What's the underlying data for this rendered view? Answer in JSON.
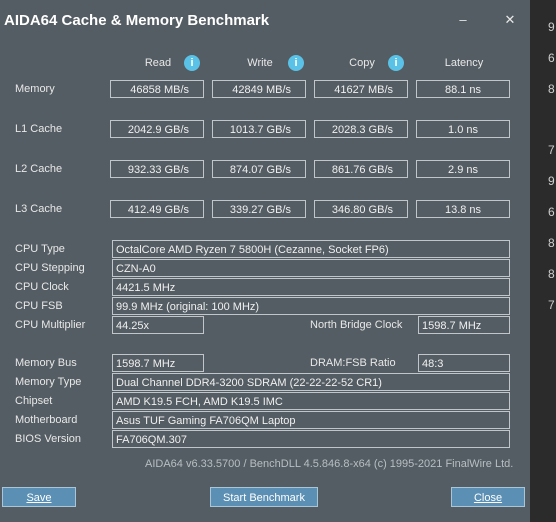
{
  "window": {
    "title": "AIDA64 Cache & Memory Benchmark",
    "minimize_glyph": "–",
    "close_glyph": "✕"
  },
  "columns": {
    "read": "Read",
    "write": "Write",
    "copy": "Copy",
    "latency": "Latency",
    "info_glyph": "i"
  },
  "rows": {
    "memory": {
      "label": "Memory",
      "read": "46858 MB/s",
      "write": "42849 MB/s",
      "copy": "41627 MB/s",
      "latency": "88.1 ns"
    },
    "l1": {
      "label": "L1 Cache",
      "read": "2042.9 GB/s",
      "write": "1013.7 GB/s",
      "copy": "2028.3 GB/s",
      "latency": "1.0 ns"
    },
    "l2": {
      "label": "L2 Cache",
      "read": "932.33 GB/s",
      "write": "874.07 GB/s",
      "copy": "861.76 GB/s",
      "latency": "2.9 ns"
    },
    "l3": {
      "label": "L3 Cache",
      "read": "412.49 GB/s",
      "write": "339.27 GB/s",
      "copy": "346.80 GB/s",
      "latency": "13.8 ns"
    }
  },
  "cpu": {
    "type_label": "CPU Type",
    "type_value": "OctalCore AMD Ryzen 7 5800H  (Cezanne, Socket FP6)",
    "stepping_label": "CPU Stepping",
    "stepping_value": "CZN-A0",
    "clock_label": "CPU Clock",
    "clock_value": "4421.5 MHz",
    "fsb_label": "CPU FSB",
    "fsb_value": "99.9 MHz  (original: 100 MHz)",
    "multiplier_label": "CPU Multiplier",
    "multiplier_value": "44.25x",
    "nb_clock_label": "North Bridge Clock",
    "nb_clock_value": "1598.7 MHz"
  },
  "memory": {
    "bus_label": "Memory Bus",
    "bus_value": "1598.7 MHz",
    "ratio_label": "DRAM:FSB Ratio",
    "ratio_value": "48:3",
    "type_label": "Memory Type",
    "type_value": "Dual Channel DDR4-3200 SDRAM  (22-22-22-52 CR1)",
    "chipset_label": "Chipset",
    "chipset_value": "AMD K19.5 FCH, AMD K19.5 IMC",
    "motherboard_label": "Motherboard",
    "motherboard_value": "Asus TUF Gaming FA706QM Laptop",
    "bios_label": "BIOS Version",
    "bios_value": "FA706QM.307"
  },
  "footer": "AIDA64 v6.33.5700 / BenchDLL 4.5.846.8-x64  (c) 1995-2021 FinalWire Ltd.",
  "buttons": {
    "save": "Save",
    "start": "Start Benchmark",
    "close": "Close"
  },
  "background_digits": [
    "9",
    "6",
    "8",
    "7",
    "9",
    "6",
    "8",
    "8",
    "7"
  ]
}
